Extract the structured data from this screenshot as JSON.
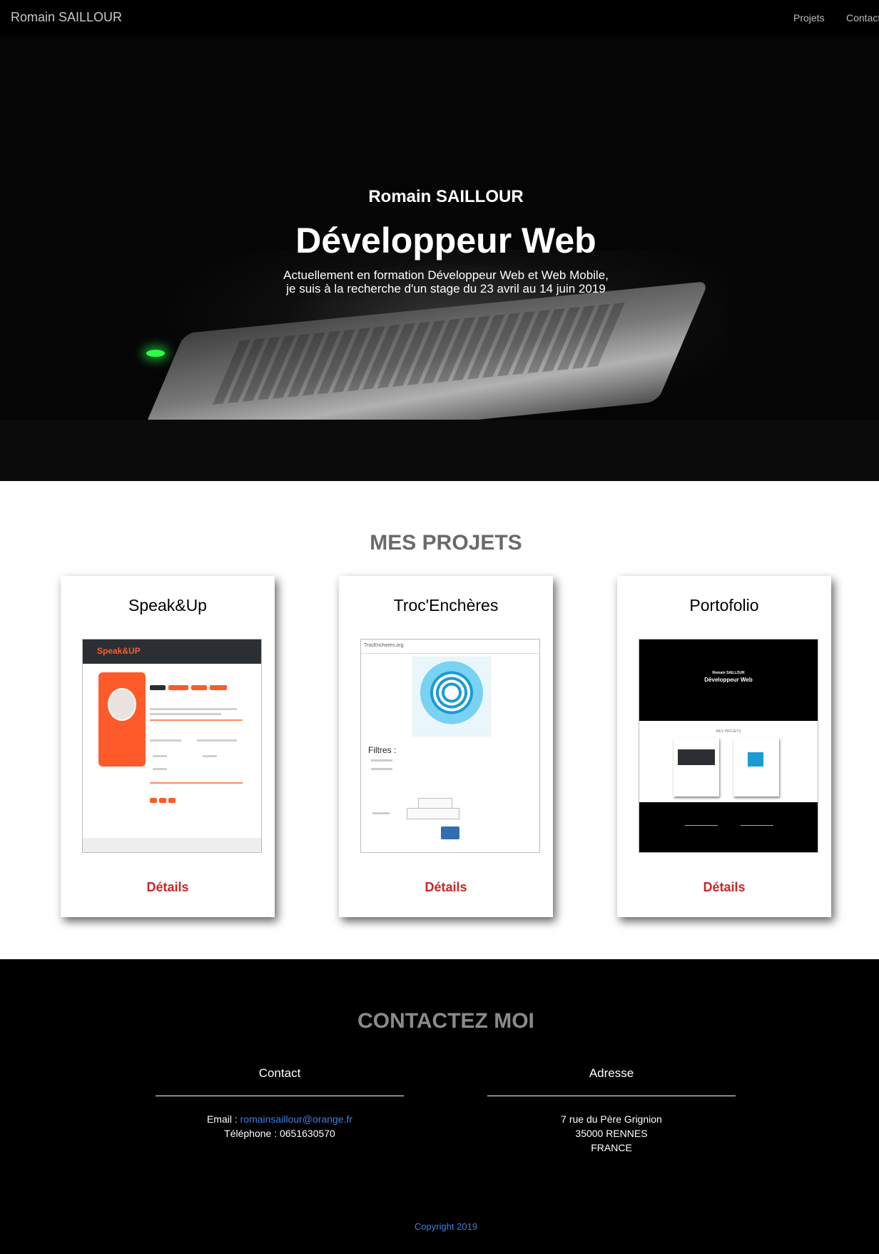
{
  "nav": {
    "brand": "Romain SAILLOUR",
    "links": [
      "Projets",
      "Contact"
    ]
  },
  "hero": {
    "name": "Romain SAILLOUR",
    "title": "Développeur Web",
    "subtitle_line1": "Actuellement en formation Développeur Web et Web Mobile,",
    "subtitle_line2": "je suis à la recherche d'un stage du 23 avril au 14 juin 2019"
  },
  "projects": {
    "title": "MES PROJETS",
    "items": [
      {
        "name": "Speak&Up",
        "details_label": "Détails",
        "thumb_logo": "Speak&UP"
      },
      {
        "name": "Troc'Enchères",
        "details_label": "Détails",
        "thumb_logo": "TrocEncheres.org",
        "thumb_filters": "Filtres :"
      },
      {
        "name": "Portofolio",
        "details_label": "Détails",
        "thumb_name": "Romain SAILLOUR",
        "thumb_title": "Développeur Web",
        "thumb_section": "MES PROJETS"
      }
    ]
  },
  "contact": {
    "title": "CONTACTEZ MOI",
    "contact_col": {
      "title": "Contact",
      "email_label": "Email : ",
      "email": "romainsaillour@orange.fr",
      "phone_label": "Téléphone : ",
      "phone": "0651630570"
    },
    "address_col": {
      "title": "Adresse",
      "line1": "7 rue du Père Grignion",
      "line2": "35000 RENNES",
      "line3": "FRANCE"
    },
    "copyright": "Copyright 2019"
  },
  "colors": {
    "accent_red": "#c62828",
    "link_blue": "#3d7fe0",
    "speakup_orange": "#ff5a2a"
  }
}
